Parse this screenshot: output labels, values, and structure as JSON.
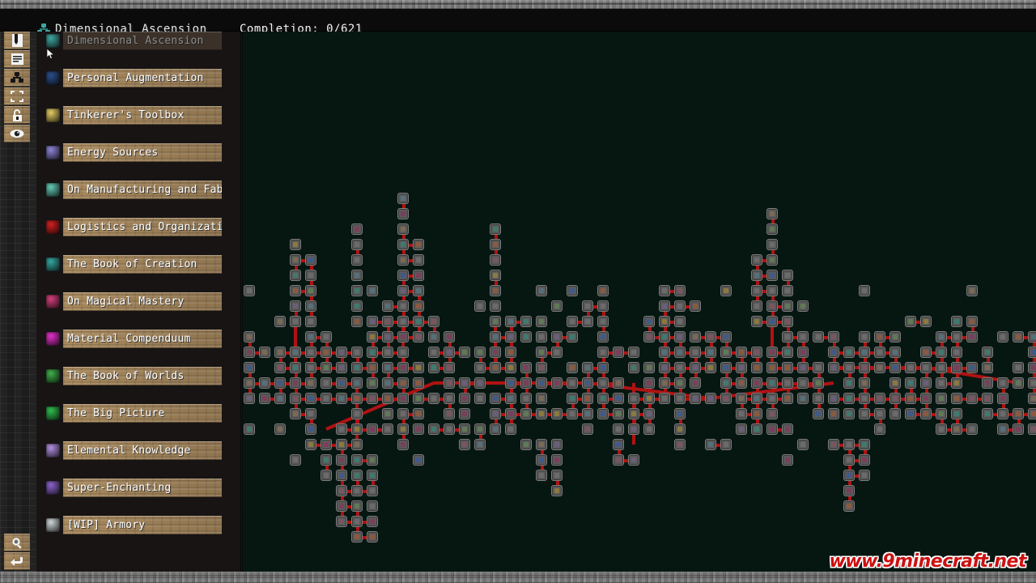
{
  "window": {
    "title": "Dimensional Ascension",
    "title_icon": "nodes-icon",
    "completion": "Completion: 0/621"
  },
  "toolbar": {
    "items": [
      {
        "name": "bookmark-icon",
        "tooltip": "Bookmark"
      },
      {
        "name": "list-icon",
        "tooltip": "List"
      },
      {
        "name": "nodes-icon",
        "tooltip": "Nodes"
      },
      {
        "name": "fullscreen-icon",
        "tooltip": "Fullscreen"
      },
      {
        "name": "lock-icon",
        "tooltip": "Lock"
      },
      {
        "name": "eye-icon",
        "tooltip": "Visibility"
      }
    ],
    "bottom_items": [
      {
        "name": "search-icon",
        "tooltip": "Search"
      },
      {
        "name": "back-icon",
        "tooltip": "Back"
      }
    ]
  },
  "sidebar": {
    "categories": [
      {
        "label": "Dimensional Ascension",
        "icon": "nodes-icon",
        "color": "#3fa5a0",
        "selected": true
      },
      {
        "label": "Personal Augmentation",
        "icon": "helmet-icon",
        "color": "#2a4f8a",
        "selected": false
      },
      {
        "label": "Tinkerer's Toolbox",
        "icon": "pattern-icon",
        "color": "#e3cb62",
        "selected": false
      },
      {
        "label": "Energy Sources",
        "icon": "energy-icon",
        "color": "#8e84d6",
        "selected": false
      },
      {
        "label": "On Manufacturing and Fab",
        "icon": "machine-icon",
        "color": "#63c9b4",
        "selected": false
      },
      {
        "label": "Logistics and Organization",
        "icon": "redstone-icon",
        "color": "#cf2020",
        "selected": false
      },
      {
        "label": "The Book of Creation",
        "icon": "creation-icon",
        "color": "#34a5a0",
        "selected": false
      },
      {
        "label": "On Magical Mastery",
        "icon": "magic-icon",
        "color": "#d0407a",
        "selected": false
      },
      {
        "label": "Material Compenduum",
        "icon": "ingot-icon",
        "color": "#e231c9",
        "selected": false
      },
      {
        "label": "The Book of Worlds",
        "icon": "world-icon",
        "color": "#3fae4b",
        "selected": false
      },
      {
        "label": "The Big Picture",
        "icon": "emerald-icon",
        "color": "#2fbd4e",
        "selected": false
      },
      {
        "label": "Elemental Knowledge",
        "icon": "crystal-icon",
        "color": "#b38fe0",
        "selected": false
      },
      {
        "label": "Super-Enchanting",
        "icon": "enchant-icon",
        "color": "#8a63c9",
        "selected": false
      },
      {
        "label": "[WIP] Armory",
        "icon": "chestplate-icon",
        "color": "#cfd6d8",
        "selected": false
      }
    ]
  },
  "graph": {
    "background_color": "#061712",
    "edge_color": "#b01212",
    "node_border_color": "#7e7e7e",
    "node_fill_color": "#5a5a5a",
    "node_count": 621,
    "unlocked_count": 0
  },
  "watermark": {
    "text": "www.9minecraft.net"
  }
}
